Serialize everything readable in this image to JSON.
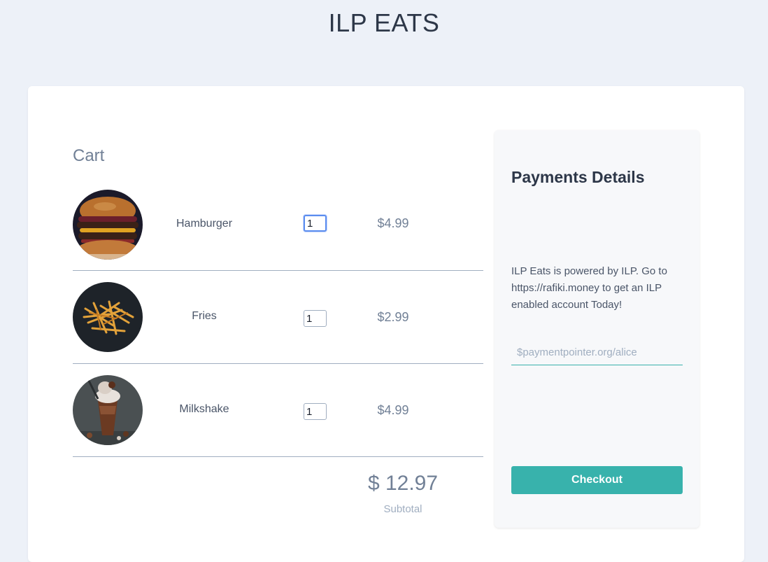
{
  "app": {
    "title": "ILP EATS"
  },
  "cart": {
    "heading": "Cart",
    "items": [
      {
        "name": "Hamburger",
        "quantity": "1",
        "price": "$4.99",
        "icon": "hamburger-image"
      },
      {
        "name": "Fries",
        "quantity": "1",
        "price": "$2.99",
        "icon": "fries-image"
      },
      {
        "name": "Milkshake",
        "quantity": "1",
        "price": "$4.99",
        "icon": "milkshake-image"
      }
    ],
    "subtotal_amount": "$ 12.97",
    "subtotal_label": "Subtotal"
  },
  "payment": {
    "title": "Payments Details",
    "description": "ILP Eats is powered by ILP. Go to https://rafiki.money to get an ILP enabled account Today!",
    "pointer_placeholder": "$paymentpointer.org/alice",
    "checkout_label": "Checkout"
  },
  "colors": {
    "background": "#edf1f8",
    "accent": "#38b2ac",
    "focus": "#5b8def"
  }
}
